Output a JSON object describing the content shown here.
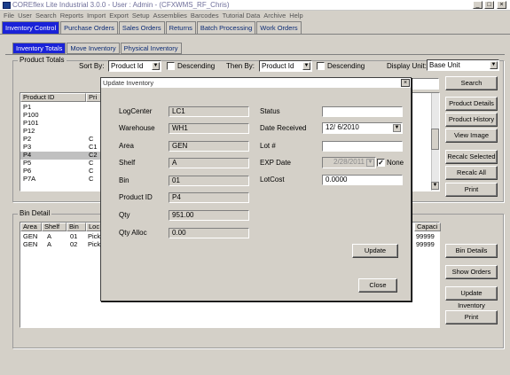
{
  "app": {
    "title": "COREflex Lite Industrial 3.0.0 - User : Admin - (CFXWMS_RF_Chris)"
  },
  "menu": [
    "File",
    "User",
    "Search",
    "Reports",
    "Import",
    "Export",
    "Setup",
    "Assemblies",
    "Barcodes",
    "Tutorial Data",
    "Archive",
    "Help"
  ],
  "main_tabs": [
    "Inventory Control",
    "Purchase Orders",
    "Sales Orders",
    "Returns",
    "Batch Processing",
    "Work Orders"
  ],
  "sub_tabs": [
    "Inventory Totals",
    "Move Inventory",
    "Physical Inventory"
  ],
  "product_totals": {
    "group_label": "Product Totals",
    "sort_by_label": "Sort By:",
    "sort_by_value": "Product Id",
    "descending_label": "Descending",
    "then_by_label": "Then By:",
    "then_by_value": "Product Id",
    "descending2_label": "Descending",
    "display_unit_label": "Display Unit:",
    "display_unit_value": "Base Unit",
    "columns": [
      "Product ID",
      "Pri"
    ],
    "rows": [
      [
        "P1",
        ""
      ],
      [
        "P100",
        ""
      ],
      [
        "P101",
        ""
      ],
      [
        "P12",
        ""
      ],
      [
        "P2",
        "C"
      ],
      [
        "P3",
        "C1"
      ],
      [
        "P4",
        "C2"
      ],
      [
        "P5",
        "C"
      ],
      [
        "P6",
        "C"
      ],
      [
        "P7A",
        "C"
      ]
    ],
    "buttons": [
      "Search",
      "Product Details",
      "Product History",
      "View Image",
      "Recalc Selected",
      "Recalc All",
      "Print"
    ]
  },
  "bin_detail": {
    "group_label": "Bin Detail",
    "columns": [
      "Area",
      "Shelf",
      "Bin",
      "Loc"
    ],
    "capacity_header": "Capaci",
    "rows": [
      [
        "GEN",
        "A",
        "01",
        "Pick",
        "99999"
      ],
      [
        "GEN",
        "A",
        "02",
        "Pick",
        "99999"
      ]
    ],
    "buttons": [
      "Bin Details",
      "Show Orders",
      "Update Inventory",
      "Print"
    ]
  },
  "dialog": {
    "title": "Update Inventory",
    "fields_left": [
      {
        "label": "LogCenter",
        "value": "LC1"
      },
      {
        "label": "Warehouse",
        "value": "WH1"
      },
      {
        "label": "Area",
        "value": "GEN"
      },
      {
        "label": "Shelf",
        "value": "A"
      },
      {
        "label": "Bin",
        "value": "01"
      },
      {
        "label": "Product ID",
        "value": "P4"
      },
      {
        "label": "Qty",
        "value": "951.00"
      },
      {
        "label": "Qty Alloc",
        "value": "0.00"
      }
    ],
    "status_label": "Status",
    "status_value": "",
    "date_received_label": "Date Received",
    "date_received_value": "12/ 6/2010",
    "lot_label": "Lot #",
    "lot_value": "",
    "exp_date_label": "EXP Date",
    "exp_date_value": "2/28/2011",
    "none_label": "None",
    "lotcost_label": "LotCost",
    "lotcost_value": "0.0000",
    "update_button": "Update",
    "close_button": "Close"
  }
}
